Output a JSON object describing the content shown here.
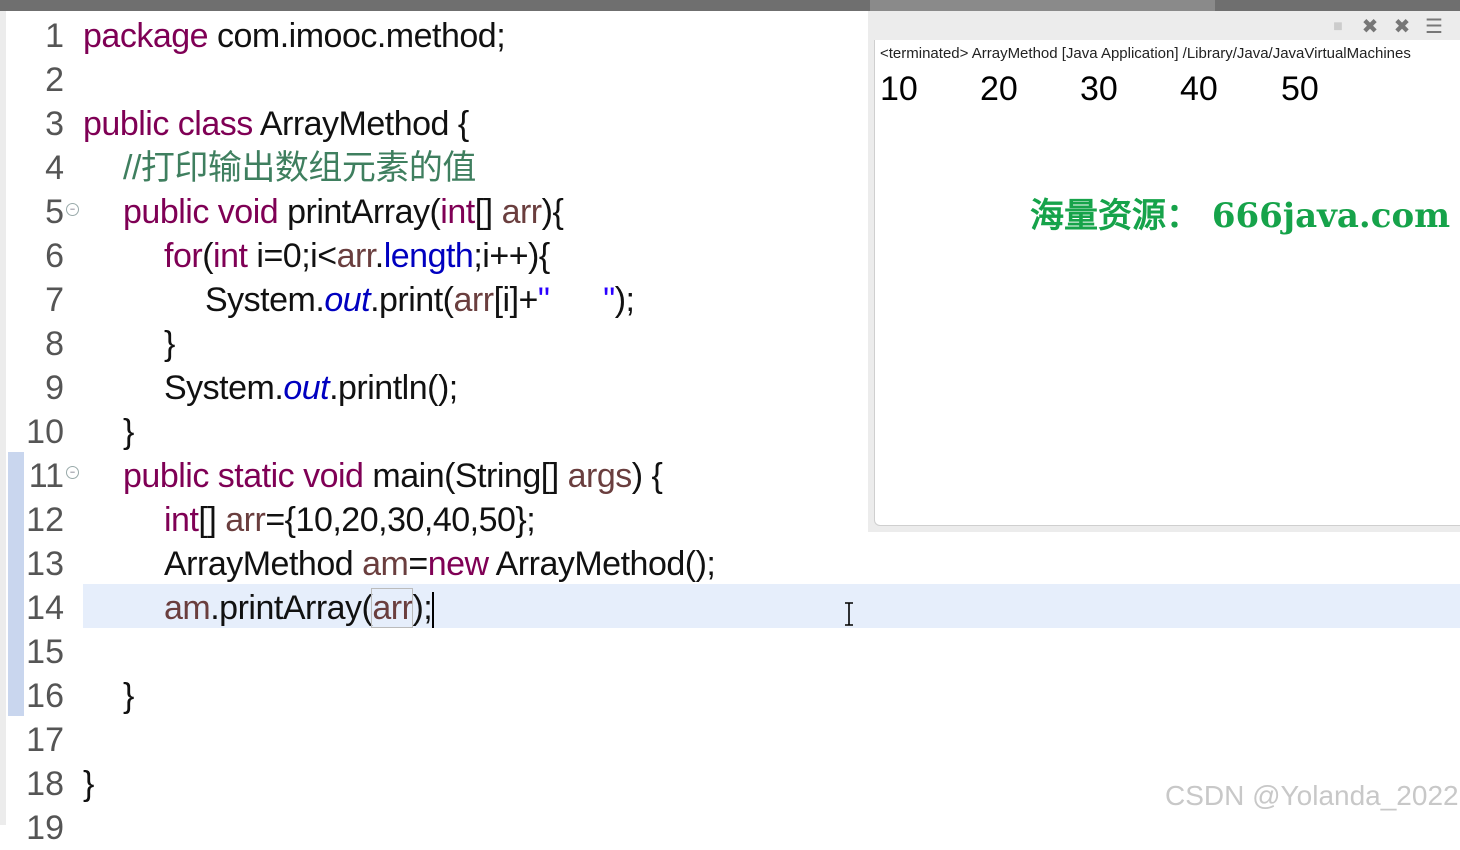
{
  "editor": {
    "line_numbers": [
      "1",
      "2",
      "3",
      "4",
      "5",
      "6",
      "7",
      "8",
      "9",
      "10",
      "11",
      "12",
      "13",
      "14",
      "15",
      "16",
      "17",
      "18",
      "19"
    ],
    "lines": {
      "l1": {
        "kw": "package",
        "rest": " com.imooc.method;"
      },
      "l3": {
        "kw": "public class",
        "rest": " ArrayMethod {"
      },
      "l4": {
        "comment": "//打印输出数组元素的值"
      },
      "l5": {
        "kw": "public void",
        "a": " printArray(",
        "kw2": "int",
        "b": "[] ",
        "var": "arr",
        "c": "){"
      },
      "l6": {
        "kw": "for",
        "a": "(",
        "kw2": "int",
        "b": " i=0;i<",
        "var": "arr",
        "c": ".",
        "fld": "length",
        "d": ";i++){"
      },
      "l7": {
        "a": "System.",
        "fld": "out",
        "b": ".print(",
        "var": "arr",
        "c": "[i]+",
        "str": "\"      \"",
        "d": ");"
      },
      "l8": {
        "a": "}"
      },
      "l9": {
        "a": "System.",
        "fld": "out",
        "b": ".println();"
      },
      "l10": {
        "a": "}"
      },
      "l11": {
        "kw": "public static void",
        "a": " main(String[] ",
        "var": "args",
        "b": ") {"
      },
      "l12": {
        "kw": "int",
        "a": "[] ",
        "var": "arr",
        "b": "={10,20,30,40,50};"
      },
      "l13": {
        "a": "ArrayMethod ",
        "var": "am",
        "b": "=",
        "kw": "new",
        "c": " ArrayMethod();"
      },
      "l14": {
        "var": "am",
        "a": ".printArray(",
        "var2": "arr",
        "b": ");"
      },
      "l16": {
        "a": "}"
      },
      "l18": {
        "a": "}"
      }
    }
  },
  "console": {
    "header": "<terminated> ArrayMethod [Java Application] /Library/Java/JavaVirtualMachines",
    "output": [
      "10",
      "20",
      "30",
      "40",
      "50"
    ],
    "tools": {
      "stop": "■",
      "remove": "✖",
      "remove_all": "✖",
      "log": "☰"
    }
  },
  "watermarks": {
    "resource": "海量资源：  666java.com",
    "csdn": "CSDN @Yolanda_2022"
  },
  "colors": {
    "keyword": "#7f0055",
    "comment": "#3f7f5f",
    "field": "#0000c0",
    "variable": "#6a3e3e",
    "watermark": "#16a34a"
  }
}
